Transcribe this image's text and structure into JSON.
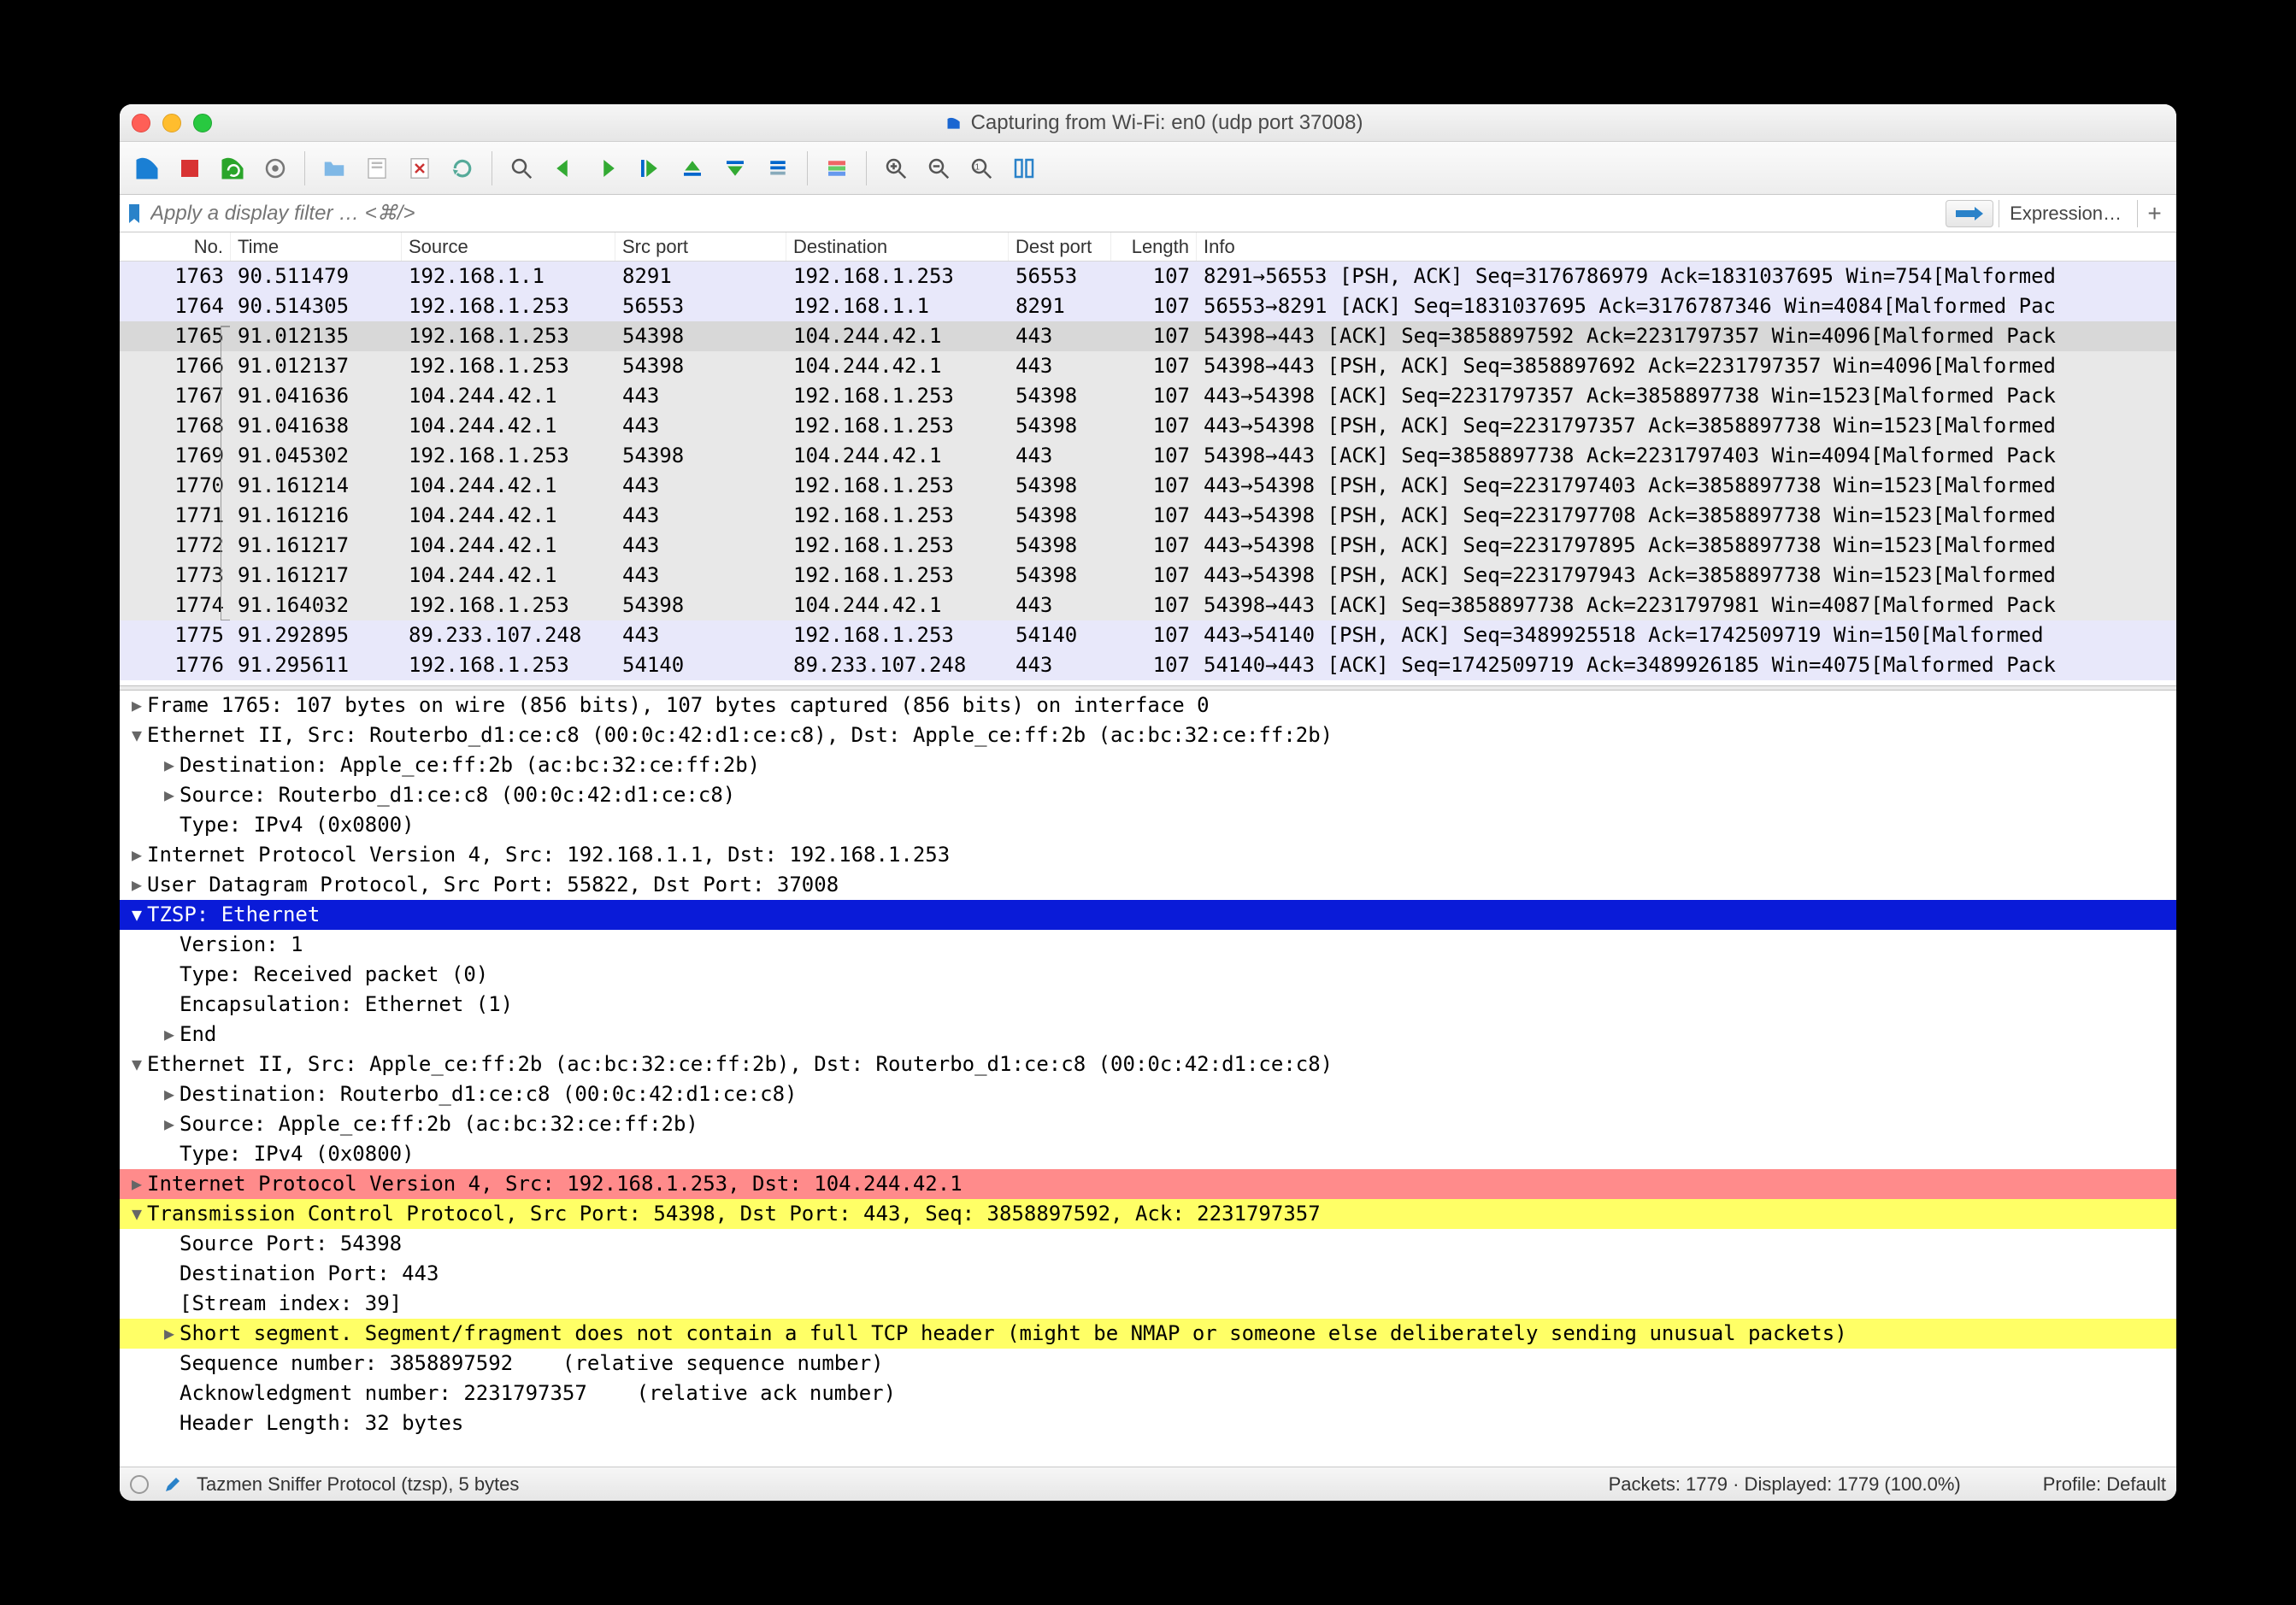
{
  "window": {
    "title": "Capturing from Wi-Fi: en0 (udp port 37008)"
  },
  "filter": {
    "placeholder": "Apply a display filter … <⌘/>",
    "expression_label": "Expression…"
  },
  "columns": {
    "no": "No.",
    "time": "Time",
    "source": "Source",
    "src_port": "Src port",
    "destination": "Destination",
    "dest_port": "Dest port",
    "length": "Length",
    "info": "Info"
  },
  "packets": [
    {
      "no": "1763",
      "time": "90.511479",
      "src": "192.168.1.1",
      "sport": "8291",
      "dst": "192.168.1.253",
      "dport": "56553",
      "len": "107",
      "info": "8291→56553 [PSH, ACK] Seq=3176786979 Ack=1831037695 Win=754[Malformed",
      "cls": "bg-lav"
    },
    {
      "no": "1764",
      "time": "90.514305",
      "src": "192.168.1.253",
      "sport": "56553",
      "dst": "192.168.1.1",
      "dport": "8291",
      "len": "107",
      "info": "56553→8291 [ACK] Seq=1831037695 Ack=3176787346 Win=4084[Malformed Pac",
      "cls": "bg-lav"
    },
    {
      "no": "1765",
      "time": "91.012135",
      "src": "192.168.1.253",
      "sport": "54398",
      "dst": "104.244.42.1",
      "dport": "443",
      "len": "107",
      "info": "54398→443 [ACK] Seq=3858897592 Ack=2231797357 Win=4096[Malformed Pack",
      "cls": "bg-sel"
    },
    {
      "no": "1766",
      "time": "91.012137",
      "src": "192.168.1.253",
      "sport": "54398",
      "dst": "104.244.42.1",
      "dport": "443",
      "len": "107",
      "info": "54398→443 [PSH, ACK] Seq=3858897692 Ack=2231797357 Win=4096[Malformed",
      "cls": "bg-gray"
    },
    {
      "no": "1767",
      "time": "91.041636",
      "src": "104.244.42.1",
      "sport": "443",
      "dst": "192.168.1.253",
      "dport": "54398",
      "len": "107",
      "info": "443→54398 [ACK] Seq=2231797357 Ack=3858897738 Win=1523[Malformed Pack",
      "cls": "bg-gray"
    },
    {
      "no": "1768",
      "time": "91.041638",
      "src": "104.244.42.1",
      "sport": "443",
      "dst": "192.168.1.253",
      "dport": "54398",
      "len": "107",
      "info": "443→54398 [PSH, ACK] Seq=2231797357 Ack=3858897738 Win=1523[Malformed",
      "cls": "bg-gray"
    },
    {
      "no": "1769",
      "time": "91.045302",
      "src": "192.168.1.253",
      "sport": "54398",
      "dst": "104.244.42.1",
      "dport": "443",
      "len": "107",
      "info": "54398→443 [ACK] Seq=3858897738 Ack=2231797403 Win=4094[Malformed Pack",
      "cls": "bg-gray"
    },
    {
      "no": "1770",
      "time": "91.161214",
      "src": "104.244.42.1",
      "sport": "443",
      "dst": "192.168.1.253",
      "dport": "54398",
      "len": "107",
      "info": "443→54398 [PSH, ACK] Seq=2231797403 Ack=3858897738 Win=1523[Malformed",
      "cls": "bg-gray"
    },
    {
      "no": "1771",
      "time": "91.161216",
      "src": "104.244.42.1",
      "sport": "443",
      "dst": "192.168.1.253",
      "dport": "54398",
      "len": "107",
      "info": "443→54398 [PSH, ACK] Seq=2231797708 Ack=3858897738 Win=1523[Malformed",
      "cls": "bg-gray"
    },
    {
      "no": "1772",
      "time": "91.161217",
      "src": "104.244.42.1",
      "sport": "443",
      "dst": "192.168.1.253",
      "dport": "54398",
      "len": "107",
      "info": "443→54398 [PSH, ACK] Seq=2231797895 Ack=3858897738 Win=1523[Malformed",
      "cls": "bg-gray"
    },
    {
      "no": "1773",
      "time": "91.161217",
      "src": "104.244.42.1",
      "sport": "443",
      "dst": "192.168.1.253",
      "dport": "54398",
      "len": "107",
      "info": "443→54398 [PSH, ACK] Seq=2231797943 Ack=3858897738 Win=1523[Malformed",
      "cls": "bg-gray"
    },
    {
      "no": "1774",
      "time": "91.164032",
      "src": "192.168.1.253",
      "sport": "54398",
      "dst": "104.244.42.1",
      "dport": "443",
      "len": "107",
      "info": "54398→443 [ACK] Seq=3858897738 Ack=2231797981 Win=4087[Malformed Pack",
      "cls": "bg-gray"
    },
    {
      "no": "1775",
      "time": "91.292895",
      "src": "89.233.107.248",
      "sport": "443",
      "dst": "192.168.1.253",
      "dport": "54140",
      "len": "107",
      "info": "443→54140 [PSH, ACK] Seq=3489925518 Ack=1742509719 Win=150[Malformed",
      "cls": "bg-lav"
    },
    {
      "no": "1776",
      "time": "91.295611",
      "src": "192.168.1.253",
      "sport": "54140",
      "dst": "89.233.107.248",
      "dport": "443",
      "len": "107",
      "info": "54140→443 [ACK] Seq=1742509719 Ack=3489926185 Win=4075[Malformed Pack",
      "cls": "bg-lav"
    }
  ],
  "details": [
    {
      "ind": 0,
      "tri": "col",
      "text": "Frame 1765: 107 bytes on wire (856 bits), 107 bytes captured (856 bits) on interface 0",
      "cls": ""
    },
    {
      "ind": 0,
      "tri": "exp",
      "text": "Ethernet II, Src: Routerbo_d1:ce:c8 (00:0c:42:d1:ce:c8), Dst: Apple_ce:ff:2b (ac:bc:32:ce:ff:2b)",
      "cls": ""
    },
    {
      "ind": 1,
      "tri": "col",
      "text": "Destination: Apple_ce:ff:2b (ac:bc:32:ce:ff:2b)",
      "cls": ""
    },
    {
      "ind": 1,
      "tri": "col",
      "text": "Source: Routerbo_d1:ce:c8 (00:0c:42:d1:ce:c8)",
      "cls": ""
    },
    {
      "ind": 1,
      "tri": "",
      "text": "Type: IPv4 (0x0800)",
      "cls": ""
    },
    {
      "ind": 0,
      "tri": "col",
      "text": "Internet Protocol Version 4, Src: 192.168.1.1, Dst: 192.168.1.253",
      "cls": ""
    },
    {
      "ind": 0,
      "tri": "col",
      "text": "User Datagram Protocol, Src Port: 55822, Dst Port: 37008",
      "cls": ""
    },
    {
      "ind": 0,
      "tri": "exp",
      "text": "TZSP: Ethernet",
      "cls": "hl-blue"
    },
    {
      "ind": 1,
      "tri": "",
      "text": "Version: 1",
      "cls": ""
    },
    {
      "ind": 1,
      "tri": "",
      "text": "Type: Received packet (0)",
      "cls": ""
    },
    {
      "ind": 1,
      "tri": "",
      "text": "Encapsulation: Ethernet (1)",
      "cls": ""
    },
    {
      "ind": 1,
      "tri": "col",
      "text": "End",
      "cls": ""
    },
    {
      "ind": 0,
      "tri": "exp",
      "text": "Ethernet II, Src: Apple_ce:ff:2b (ac:bc:32:ce:ff:2b), Dst: Routerbo_d1:ce:c8 (00:0c:42:d1:ce:c8)",
      "cls": ""
    },
    {
      "ind": 1,
      "tri": "col",
      "text": "Destination: Routerbo_d1:ce:c8 (00:0c:42:d1:ce:c8)",
      "cls": ""
    },
    {
      "ind": 1,
      "tri": "col",
      "text": "Source: Apple_ce:ff:2b (ac:bc:32:ce:ff:2b)",
      "cls": ""
    },
    {
      "ind": 1,
      "tri": "",
      "text": "Type: IPv4 (0x0800)",
      "cls": ""
    },
    {
      "ind": 0,
      "tri": "col",
      "text": "Internet Protocol Version 4, Src: 192.168.1.253, Dst: 104.244.42.1",
      "cls": "hl-red"
    },
    {
      "ind": 0,
      "tri": "exp",
      "text": "Transmission Control Protocol, Src Port: 54398, Dst Port: 443, Seq: 3858897592, Ack: 2231797357",
      "cls": "hl-yel"
    },
    {
      "ind": 1,
      "tri": "",
      "text": "Source Port: 54398",
      "cls": ""
    },
    {
      "ind": 1,
      "tri": "",
      "text": "Destination Port: 443",
      "cls": ""
    },
    {
      "ind": 1,
      "tri": "",
      "text": "[Stream index: 39]",
      "cls": ""
    },
    {
      "ind": 1,
      "tri": "col",
      "text": "Short segment. Segment/fragment does not contain a full TCP header (might be NMAP or someone else deliberately sending unusual packets)",
      "cls": "hl-yel"
    },
    {
      "ind": 1,
      "tri": "",
      "text": "Sequence number: 3858897592    (relative sequence number)",
      "cls": ""
    },
    {
      "ind": 1,
      "tri": "",
      "text": "Acknowledgment number: 2231797357    (relative ack number)",
      "cls": ""
    },
    {
      "ind": 1,
      "tri": "",
      "text": "Header Length: 32 bytes",
      "cls": ""
    }
  ],
  "statusbar": {
    "protocol": "Tazmen Sniffer Protocol (tzsp), 5 bytes",
    "packets": "Packets: 1779 · Displayed: 1779 (100.0%)",
    "profile": "Profile: Default"
  }
}
